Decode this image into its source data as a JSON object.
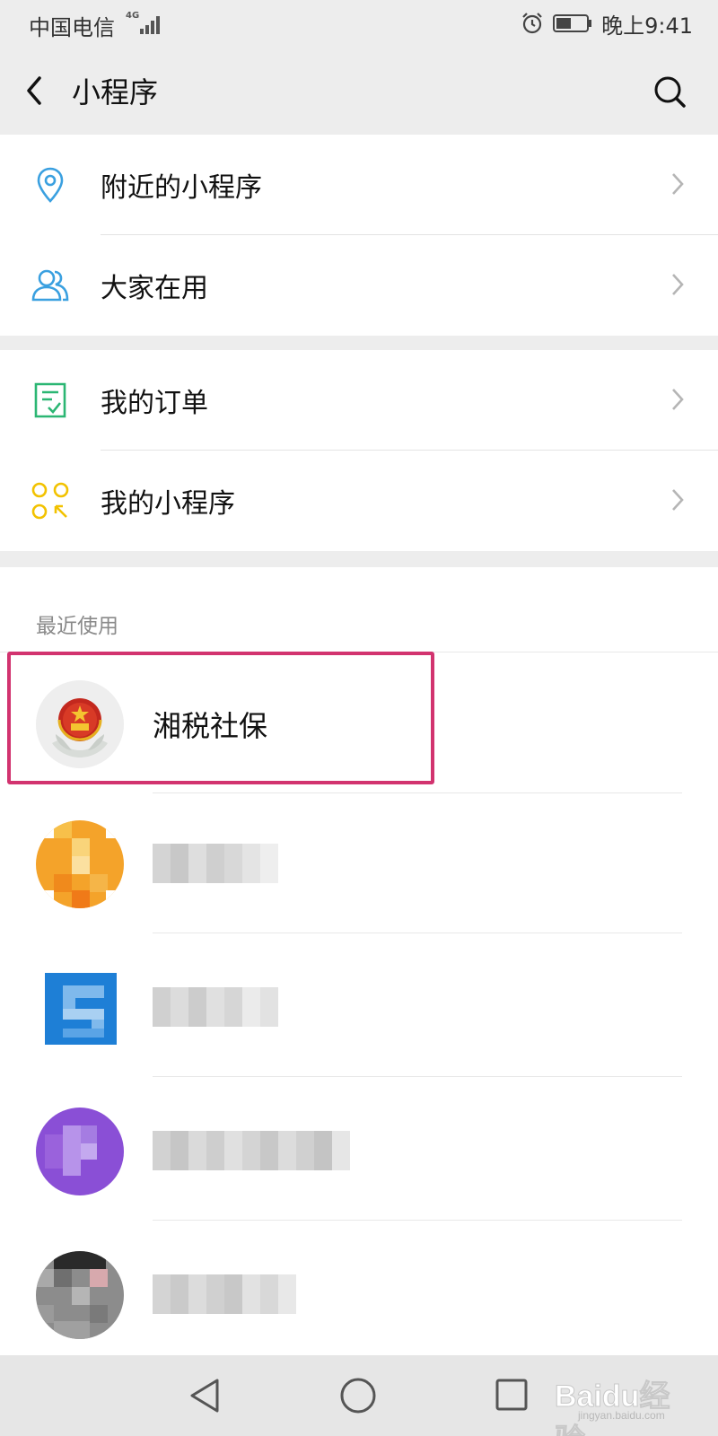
{
  "status_bar": {
    "carrier": "中国电信",
    "network": "4G",
    "time": "晚上9:41"
  },
  "nav": {
    "title": "小程序"
  },
  "menu_groups": [
    {
      "items": [
        {
          "label": "附近的小程序",
          "icon": "location-pin-icon",
          "color": "#3aa0e0"
        },
        {
          "label": "大家在用",
          "icon": "people-icon",
          "color": "#3aa0e0"
        }
      ]
    },
    {
      "items": [
        {
          "label": "我的订单",
          "icon": "order-list-icon",
          "color": "#2bb673"
        },
        {
          "label": "我的小程序",
          "icon": "mini-programs-icon",
          "color": "#f2c200"
        }
      ]
    }
  ],
  "recent": {
    "title": "最近使用",
    "apps": [
      {
        "name": "湘税社保",
        "icon": "national-emblem-icon",
        "highlighted": true
      },
      {
        "name": "",
        "icon": "blurred-orange-icon",
        "blurred": true
      },
      {
        "name": "",
        "icon": "blurred-blue-icon",
        "blurred": true
      },
      {
        "name": "",
        "icon": "blurred-purple-icon",
        "blurred": true
      },
      {
        "name": "",
        "icon": "blurred-dark-icon",
        "blurred": true
      }
    ]
  },
  "colors": {
    "highlight_border": "#d2336f",
    "background": "#ededed"
  },
  "watermark": {
    "brand": "Baidu经验",
    "site": "jingyan.baidu.com"
  }
}
